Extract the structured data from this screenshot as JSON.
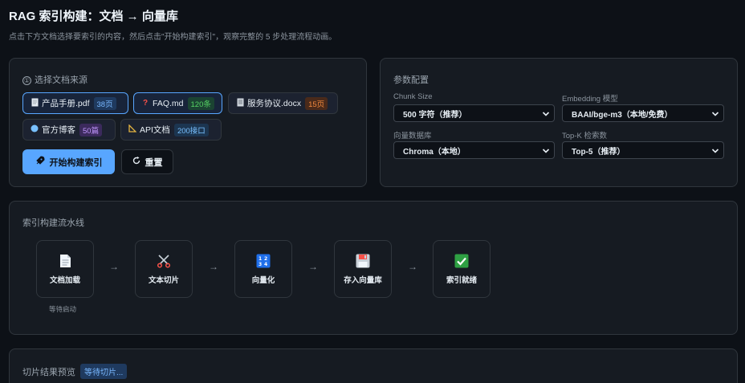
{
  "header": {
    "title": "RAG 索引构建：文档 → 向量库",
    "subtitle": "点击下方文档选择要索引的内容，然后点击\"开始构建索引\"，观察完整的 5 步处理流程动画。"
  },
  "source": {
    "step": "①",
    "title": "选择文档来源",
    "docs": [
      {
        "icon": "document-icon",
        "name": "产品手册.pdf",
        "badge": "38页",
        "color": "#79b8ff",
        "selected": true
      },
      {
        "icon": "question-icon",
        "name": "FAQ.md",
        "badge": "120条",
        "color": "#56d364",
        "selected": true
      },
      {
        "icon": "memo-icon",
        "name": "服务协议.docx",
        "badge": "15页",
        "color": "#f0883e",
        "selected": false
      },
      {
        "icon": "globe-icon",
        "name": "官方博客",
        "badge": "50篇",
        "color": "#c297ff",
        "selected": false
      },
      {
        "icon": "ruler-icon",
        "name": "API文档",
        "badge": "200接口",
        "color": "#79c0ff",
        "selected": false
      }
    ],
    "build_button": "开始构建索引",
    "reset_button": "重置"
  },
  "params": {
    "title": "参数配置",
    "fields": [
      {
        "label": "Chunk Size",
        "value": "500 字符（推荐）"
      },
      {
        "label": "Embedding 模型",
        "value": "BAAI/bge-m3（本地/免费）"
      },
      {
        "label": "向量数据库",
        "value": "Chroma（本地）"
      },
      {
        "label": "Top-K 检索数",
        "value": "Top-5（推荐）"
      }
    ]
  },
  "pipeline": {
    "title": "索引构建流水线",
    "stages": [
      {
        "icon": "page-icon",
        "label": "文档加载",
        "status": "等待启动"
      },
      {
        "icon": "scissors-icon",
        "label": "文本切片",
        "status": ""
      },
      {
        "icon": "numbers-icon",
        "label": "向量化",
        "status": ""
      },
      {
        "icon": "floppy-disk-icon",
        "label": "存入向量库",
        "status": ""
      },
      {
        "icon": "check-icon",
        "label": "索引就绪",
        "status": ""
      }
    ],
    "arrow": "→"
  },
  "preview": {
    "title": "切片结果预览",
    "badge": "等待切片..."
  }
}
